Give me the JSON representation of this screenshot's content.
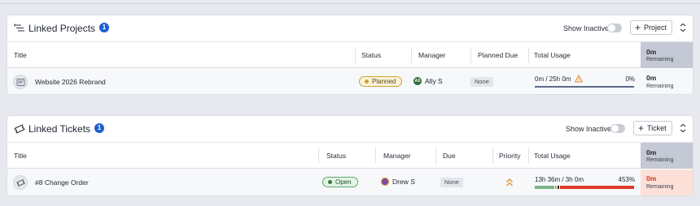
{
  "projects": {
    "title": "Linked Projects",
    "count": "1",
    "show_inactive_label": "Show Inactive",
    "add_button_label": "Project",
    "columns": [
      "Title",
      "Status",
      "Manager",
      "Planned Due",
      "Total Usage"
    ],
    "remaining_header": {
      "value": "0m",
      "label": "Remaining"
    },
    "rows": [
      {
        "title": "Website 2026 Rebrand",
        "status": "Planned",
        "manager_initials": "AS",
        "manager": "Ally S",
        "planned_due": "None",
        "usage_text": "0m / 25h 0m",
        "usage_pct": "0%",
        "usage_fraction": 0,
        "remaining_value": "0m",
        "remaining_label": "Remaining"
      }
    ]
  },
  "tickets": {
    "title": "Linked Tickets",
    "count": "1",
    "show_inactive_label": "Show Inactive",
    "add_button_label": "Ticket",
    "columns": [
      "Title",
      "Status",
      "Manager",
      "Due",
      "Priority",
      "Total Usage"
    ],
    "remaining_header": {
      "value": "0m",
      "label": "Remaining"
    },
    "rows": [
      {
        "title": "#8 Change Order",
        "status": "Open",
        "manager": "Drew S",
        "due": "None",
        "priority_icon": "double-chevron-up-icon",
        "usage_text": "13h 36m / 3h 0m",
        "usage_pct": "453%",
        "usage_fraction": 4.53,
        "remaining_value": "0m",
        "remaining_label": "Remaining"
      }
    ]
  },
  "colors": {
    "accent": "#1c5fd0",
    "planned": "#c9a23c",
    "open": "#59a86a",
    "over_budget": "#e03a2a",
    "over_budget_bg": "#fde1d8",
    "remaining_header_bg": "#c5c9d5",
    "warning": "#e08a2c",
    "priority": "#e0962c"
  }
}
